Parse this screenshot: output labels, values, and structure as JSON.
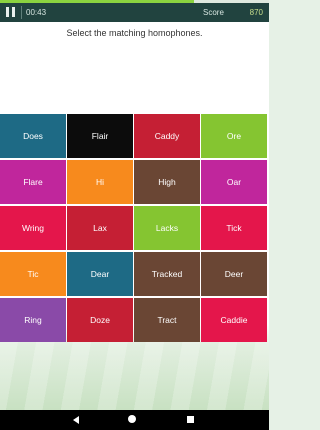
{
  "progress": 0.72,
  "topbar": {
    "timer": "00:43",
    "score_label": "Score",
    "score_value": "870"
  },
  "instruction": "Select the matching homophones.",
  "tiles": [
    {
      "label": "Does",
      "color": "#1e6a85"
    },
    {
      "label": "Flair",
      "color": "#0c0c0c"
    },
    {
      "label": "Caddy",
      "color": "#c51f34"
    },
    {
      "label": "Ore",
      "color": "#85c531"
    },
    {
      "label": "Flare",
      "color": "#c0269c"
    },
    {
      "label": "Hi",
      "color": "#f78a1d"
    },
    {
      "label": "High",
      "color": "#6a4634"
    },
    {
      "label": "Oar",
      "color": "#c0269c"
    },
    {
      "label": "Wring",
      "color": "#e4164b"
    },
    {
      "label": "Lax",
      "color": "#c51f34"
    },
    {
      "label": "Lacks",
      "color": "#85c531"
    },
    {
      "label": "Tick",
      "color": "#e4164b"
    },
    {
      "label": "Tic",
      "color": "#f78a1d"
    },
    {
      "label": "Dear",
      "color": "#1e6a85"
    },
    {
      "label": "Tracked",
      "color": "#6a4634"
    },
    {
      "label": "Deer",
      "color": "#6a4634"
    },
    {
      "label": "Ring",
      "color": "#8a4aa8"
    },
    {
      "label": "Doze",
      "color": "#c51f34"
    },
    {
      "label": "Tract",
      "color": "#6a4634"
    },
    {
      "label": "Caddie",
      "color": "#e4164b"
    }
  ]
}
